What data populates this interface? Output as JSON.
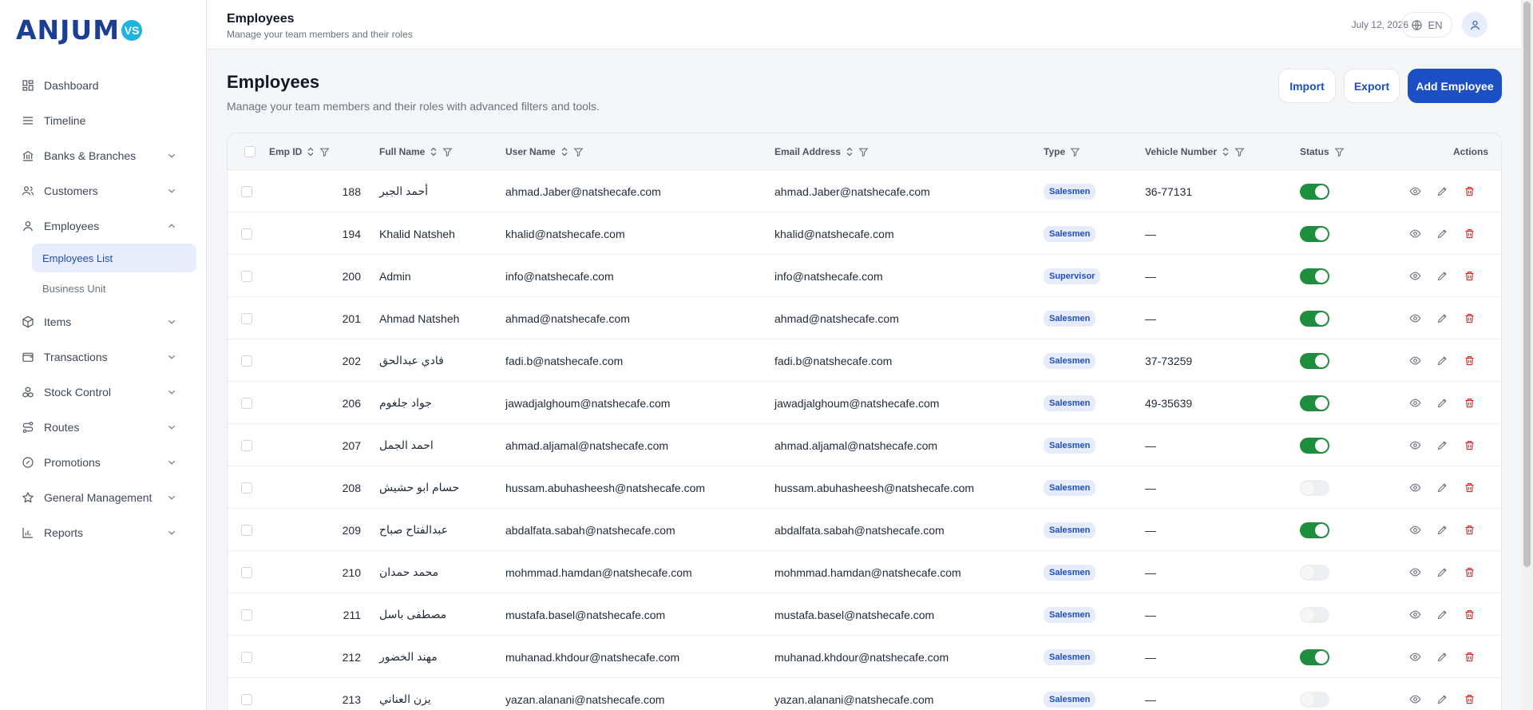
{
  "logo": {
    "text": "ANJUM",
    "badge": "VS"
  },
  "sidebar": {
    "items": [
      {
        "label": "Dashboard",
        "icon": "dashboard-icon",
        "chevron": false
      },
      {
        "label": "Timeline",
        "icon": "list-icon",
        "chevron": false
      },
      {
        "label": "Banks & Branches",
        "icon": "bank-icon",
        "chevron": "down"
      },
      {
        "label": "Customers",
        "icon": "users-icon",
        "chevron": "down"
      },
      {
        "label": "Employees",
        "icon": "user-icon",
        "chevron": "up"
      },
      {
        "label": "Items",
        "icon": "box-icon",
        "chevron": "down"
      },
      {
        "label": "Transactions",
        "icon": "wallet-icon",
        "chevron": "down"
      },
      {
        "label": "Stock Control",
        "icon": "boxes-icon",
        "chevron": "down"
      },
      {
        "label": "Routes",
        "icon": "route-icon",
        "chevron": "down"
      },
      {
        "label": "Promotions",
        "icon": "badge-icon",
        "chevron": "down"
      },
      {
        "label": "General Management",
        "icon": "star-icon",
        "chevron": "down"
      },
      {
        "label": "Reports",
        "icon": "chart-icon",
        "chevron": "down"
      }
    ],
    "employees_sub": [
      "Employees List",
      "Business Unit"
    ]
  },
  "topbar": {
    "title": "Employees",
    "subtitle": "Manage your team members and their roles",
    "date": "July 12, 2026",
    "lang": "EN"
  },
  "page": {
    "title": "Employees",
    "subtitle": "Manage your team members and their roles with advanced filters and tools.",
    "import_label": "Import",
    "export_label": "Export",
    "add_label": "Add Employee"
  },
  "table": {
    "headers": {
      "emp_id": "Emp ID",
      "full_name": "Full Name",
      "user_name": "User Name",
      "email": "Email Address",
      "type": "Type",
      "vehicle": "Vehicle Number",
      "status": "Status",
      "actions": "Actions"
    },
    "rows": [
      {
        "id": "188",
        "name": "أحمد الجبر",
        "user": "ahmad.Jaber@natshecafe.com",
        "email": "ahmad.Jaber@natshecafe.com",
        "type": "Salesmen",
        "vehicle": "36-77131",
        "active": true
      },
      {
        "id": "194",
        "name": "Khalid Natsheh",
        "user": "khalid@natshecafe.com",
        "email": "khalid@natshecafe.com",
        "type": "Salesmen",
        "vehicle": "—",
        "active": true
      },
      {
        "id": "200",
        "name": "Admin",
        "user": "info@natshecafe.com",
        "email": "info@natshecafe.com",
        "type": "Supervisor",
        "vehicle": "—",
        "active": true
      },
      {
        "id": "201",
        "name": "Ahmad Natsheh",
        "user": "ahmad@natshecafe.com",
        "email": "ahmad@natshecafe.com",
        "type": "Salesmen",
        "vehicle": "—",
        "active": true
      },
      {
        "id": "202",
        "name": "فادي عبدالحق",
        "user": "fadi.b@natshecafe.com",
        "email": "fadi.b@natshecafe.com",
        "type": "Salesmen",
        "vehicle": "37-73259",
        "active": true
      },
      {
        "id": "206",
        "name": "جواد جلغوم",
        "user": "jawadjalghoum@natshecafe.com",
        "email": "jawadjalghoum@natshecafe.com",
        "type": "Salesmen",
        "vehicle": "49-35639",
        "active": true
      },
      {
        "id": "207",
        "name": "احمد الجمل",
        "user": "ahmad.aljamal@natshecafe.com",
        "email": "ahmad.aljamal@natshecafe.com",
        "type": "Salesmen",
        "vehicle": "—",
        "active": true
      },
      {
        "id": "208",
        "name": "حسام ابو حشيش",
        "user": "hussam.abuhasheesh@natshecafe.com",
        "email": "hussam.abuhasheesh@natshecafe.com",
        "type": "Salesmen",
        "vehicle": "—",
        "active": false
      },
      {
        "id": "209",
        "name": "عبدالفتاح صباح",
        "user": "abdalfata.sabah@natshecafe.com",
        "email": "abdalfata.sabah@natshecafe.com",
        "type": "Salesmen",
        "vehicle": "—",
        "active": true
      },
      {
        "id": "210",
        "name": "محمد حمدان",
        "user": "mohmmad.hamdan@natshecafe.com",
        "email": "mohmmad.hamdan@natshecafe.com",
        "type": "Salesmen",
        "vehicle": "—",
        "active": false
      },
      {
        "id": "211",
        "name": "مصطفى باسل",
        "user": "mustafa.basel@natshecafe.com",
        "email": "mustafa.basel@natshecafe.com",
        "type": "Salesmen",
        "vehicle": "—",
        "active": false
      },
      {
        "id": "212",
        "name": "مهند الخضور",
        "user": "muhanad.khdour@natshecafe.com",
        "email": "muhanad.khdour@natshecafe.com",
        "type": "Salesmen",
        "vehicle": "—",
        "active": true
      },
      {
        "id": "213",
        "name": "يزن العناني",
        "user": "yazan.alanani@natshecafe.com",
        "email": "yazan.alanani@natshecafe.com",
        "type": "Salesmen",
        "vehicle": "—",
        "active": false
      }
    ]
  },
  "colors": {
    "primary": "#1d4fc4",
    "active_toggle": "#1e8e3e",
    "delete": "#dc2626"
  }
}
